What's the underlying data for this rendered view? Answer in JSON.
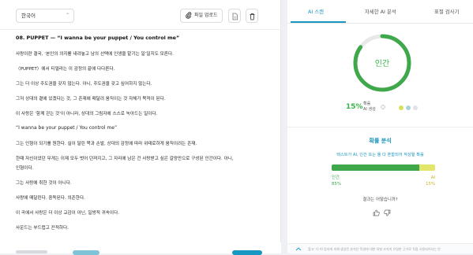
{
  "toolbar": {
    "language": "한국어",
    "upload_label": "파일 업로드",
    "icons": [
      "chevron-down-icon",
      "paperclip-icon",
      "document-icon",
      "trash-icon"
    ]
  },
  "document": {
    "lines": [
      {
        "text": "08. PUPPET — “I wanna be your puppet / You control me”",
        "kind": "title"
      },
      {
        "text": "사랑이란 결국, ‘본인의 의지를 내려놓고 남의 선택에 인생을 맡기는 일’일지도 모른다.",
        "kind": "body"
      },
      {
        "text": "〈PUPPET〉에서 티델라는 이 감정의 끝에 다다른다.",
        "kind": "body"
      },
      {
        "text": "그는 더 이상 주도권을 갖지 않는다. 아니, 주도권을 갖고 싶어하지 않는다.",
        "kind": "body"
      },
      {
        "text": "그저 상대의 곁에 있겠다는 것, 그 존재에 매달려 움직이는 것 자체가 목적이 된다.",
        "kind": "body"
      },
      {
        "text": "이 사랑은 ‘함께 걷는 것’이 아니라, 상대의 그림자에 스스로 녹아드는 일이다.",
        "kind": "body"
      },
      {
        "text": "“I wanna be your puppet / You control me”",
        "kind": "quote"
      },
      {
        "text": "그는 인형이 되기를 원한다. 실이 달린 목과 손발, 상대의 감정에 따라 위태로하게 움직이려는 존재.",
        "kind": "body"
      },
      {
        "text": "한때 자신이었던 무게는 이제 모두 벗어 던져지고, 그 자리에 남은 건 사랑받고 싶은 갈망만으로 구성된 인간이다. 아니,",
        "kind": "body"
      },
      {
        "text": "인형이다.",
        "kind": "body"
      },
      {
        "text": "그는 사랑에 취한 것이 아니다.",
        "kind": "body"
      },
      {
        "text": "사랑에 매달린다. 중독된다. 의존한다.",
        "kind": "body"
      },
      {
        "text": "이 곡에서 사랑은 더 이상 교감이 아닌, 일방적 귀속이다.",
        "kind": "body"
      },
      {
        "text": "사운드는 부드럽고 끈적하다.",
        "kind": "body"
      }
    ]
  },
  "tabs": [
    {
      "label": "AI 스캔",
      "active": true
    },
    {
      "label": "자세한 AI 분석",
      "active": false
    },
    {
      "label": "표절 검사기",
      "active": false
    }
  ],
  "result": {
    "verdict": "인간",
    "ai_percent_label": "15%",
    "ai_label_line1": "확률",
    "ai_label_line2": "AI 생성",
    "human_fraction": 0.85,
    "ring_color": "#3ea84b",
    "ring_rest_color": "#e6e8ea",
    "legend_colors": [
      "#d8df59",
      "#a8d4e0",
      "#dfe2e6"
    ]
  },
  "analysis": {
    "title": "확률 분석",
    "description": "텍스트가 AI, 인간 또는 둘 다 혼합되어 작성될 확률",
    "human_label": "인간",
    "human_pct": "85%",
    "ai_label": "AI",
    "ai_pct": "15%",
    "human_value": 85,
    "ai_value": 15,
    "human_color": "#3ea84b",
    "ai_color": "#e3e66a",
    "feedback_question": "결과는 어떻습니까?"
  },
  "footer": {
    "note": "참고: 이 AI 탐지에 의해 생성된 분석은 학생에 대한 처벌 조치의 유일한 근거로 직접 사용되어서는 안"
  }
}
